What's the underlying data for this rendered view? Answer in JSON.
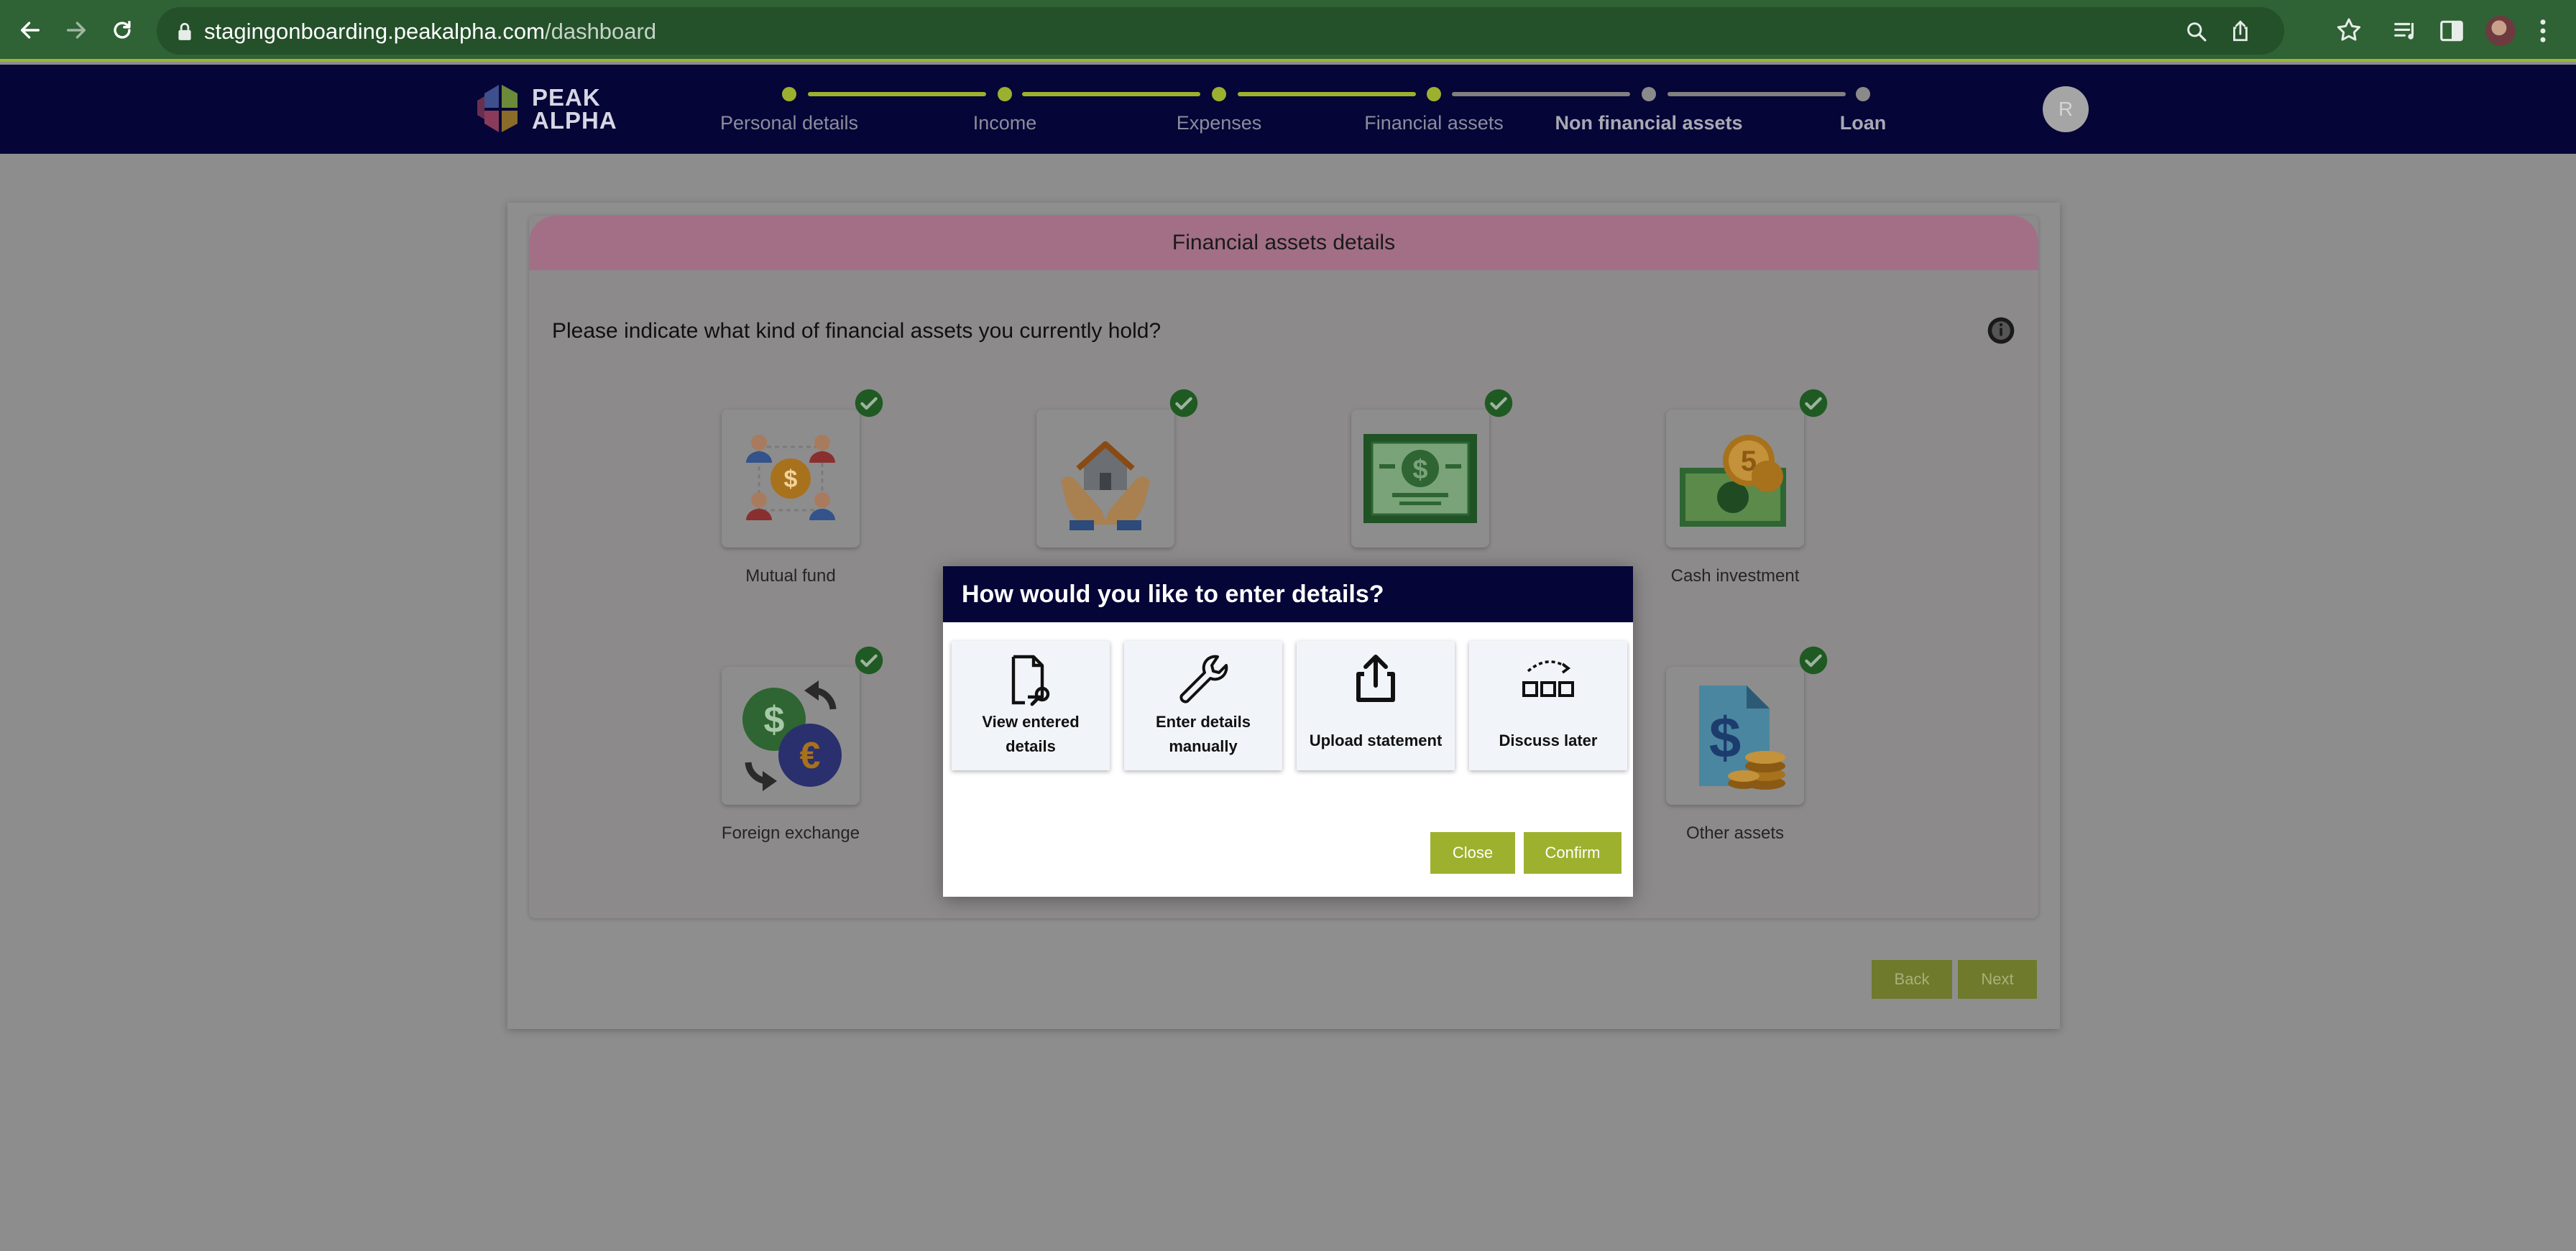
{
  "browser": {
    "url_host": "stagingonboarding.peakalpha.com",
    "url_path": "/dashboard"
  },
  "app": {
    "logo_line1": "PEAK",
    "logo_line2": "ALPHA",
    "avatar_initial": "R",
    "steps": [
      {
        "label": "Personal details",
        "status": "done"
      },
      {
        "label": "Income",
        "status": "done"
      },
      {
        "label": "Expenses",
        "status": "done"
      },
      {
        "label": "Financial assets",
        "status": "done"
      },
      {
        "label": "Non financial assets",
        "status": "active"
      },
      {
        "label": "Loan",
        "status": "todo"
      }
    ]
  },
  "card": {
    "title": "Financial assets details",
    "question": "Please indicate what kind of financial assets you currently hold?",
    "assets": [
      {
        "label": "Mutual fund",
        "icon": "mutual-fund-icon",
        "checked": true
      },
      {
        "label": "",
        "icon": "real-estate-icon",
        "checked": true
      },
      {
        "label": "",
        "icon": "banknote-icon",
        "checked": true
      },
      {
        "label": "Cash investment",
        "icon": "cash-investment-icon",
        "checked": true
      },
      {
        "label": "Foreign exchange",
        "icon": "foreign-exchange-icon",
        "checked": true
      },
      {
        "label": "Other assets",
        "icon": "other-assets-icon",
        "checked": true
      }
    ],
    "back_label": "Back",
    "next_label": "Next"
  },
  "modal": {
    "title": "How would you like to enter details?",
    "options": [
      {
        "line1": "View entered",
        "line2": "details",
        "icon": "document-search-icon"
      },
      {
        "line1": "Enter details",
        "line2": "manually",
        "icon": "wrench-icon"
      },
      {
        "line1": "Upload statement",
        "line2": "",
        "icon": "upload-icon"
      },
      {
        "line1": "Discuss later",
        "line2": "",
        "icon": "defer-icon"
      }
    ],
    "close_label": "Close",
    "confirm_label": "Confirm"
  },
  "colors": {
    "brand_navy": "#050537",
    "accent_green": "#9eb12f",
    "check_green": "#2e7d32",
    "banner_pink": "#e8a7c5"
  }
}
